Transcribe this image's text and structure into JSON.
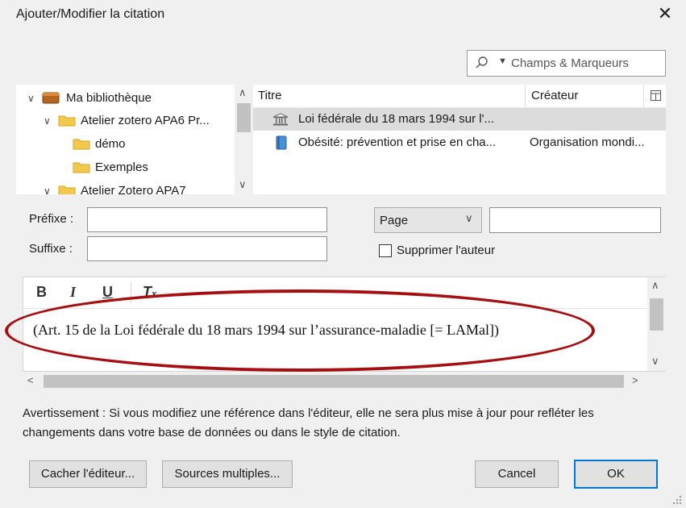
{
  "window": {
    "title": "Ajouter/Modifier la citation",
    "close_glyph": "✕"
  },
  "search": {
    "placeholder": "Champs & Marqueurs",
    "icon": "search-icon"
  },
  "tree": {
    "items": [
      {
        "label": "Ma bibliothèque",
        "icon": "library-icon",
        "expanded": true
      },
      {
        "label": "Atelier zotero APA6 Pr...",
        "icon": "folder-icon",
        "expanded": true
      },
      {
        "label": "démo",
        "icon": "folder-icon"
      },
      {
        "label": "Exemples",
        "icon": "folder-icon"
      },
      {
        "label": "Atelier Zotero APA7",
        "icon": "folder-icon",
        "expanded": true
      }
    ]
  },
  "items": {
    "col_title": "Titre",
    "col_creator": "Créateur",
    "rows": [
      {
        "title": "Loi fédérale du 18 mars 1994 sur l'...",
        "creator": "",
        "icon": "statute-icon",
        "selected": true
      },
      {
        "title": "Obésité: prévention et prise en cha...",
        "creator": "Organisation mondi...",
        "icon": "book-icon",
        "selected": false
      }
    ]
  },
  "form": {
    "prefix_label": "Préfixe :",
    "suffix_label": "Suffixe :",
    "prefix_value": "",
    "suffix_value": "",
    "locator_selected": "Page",
    "locator_value": "",
    "suppress_author_label": "Supprimer l'auteur",
    "suppress_author_checked": false
  },
  "editor": {
    "bold": "B",
    "italic": "I",
    "underline": "U",
    "clear": "T",
    "text": "(Art. 15 de la Loi fédérale du 18 mars 1994 sur l’assurance-maladie [= LAMal])"
  },
  "warning": "Avertissement : Si vous modifiez une référence dans l'éditeur, elle ne sera plus mise à jour pour refléter les changements dans votre base de données ou dans le style de citation.",
  "buttons": {
    "hide_editor": "Cacher l'éditeur...",
    "multiple_sources": "Sources multiples...",
    "cancel": "Cancel",
    "ok": "OK"
  },
  "colors": {
    "highlight_ellipse": "#a50f12",
    "primary_border": "#0078d7",
    "folder": "#f2c94c"
  }
}
